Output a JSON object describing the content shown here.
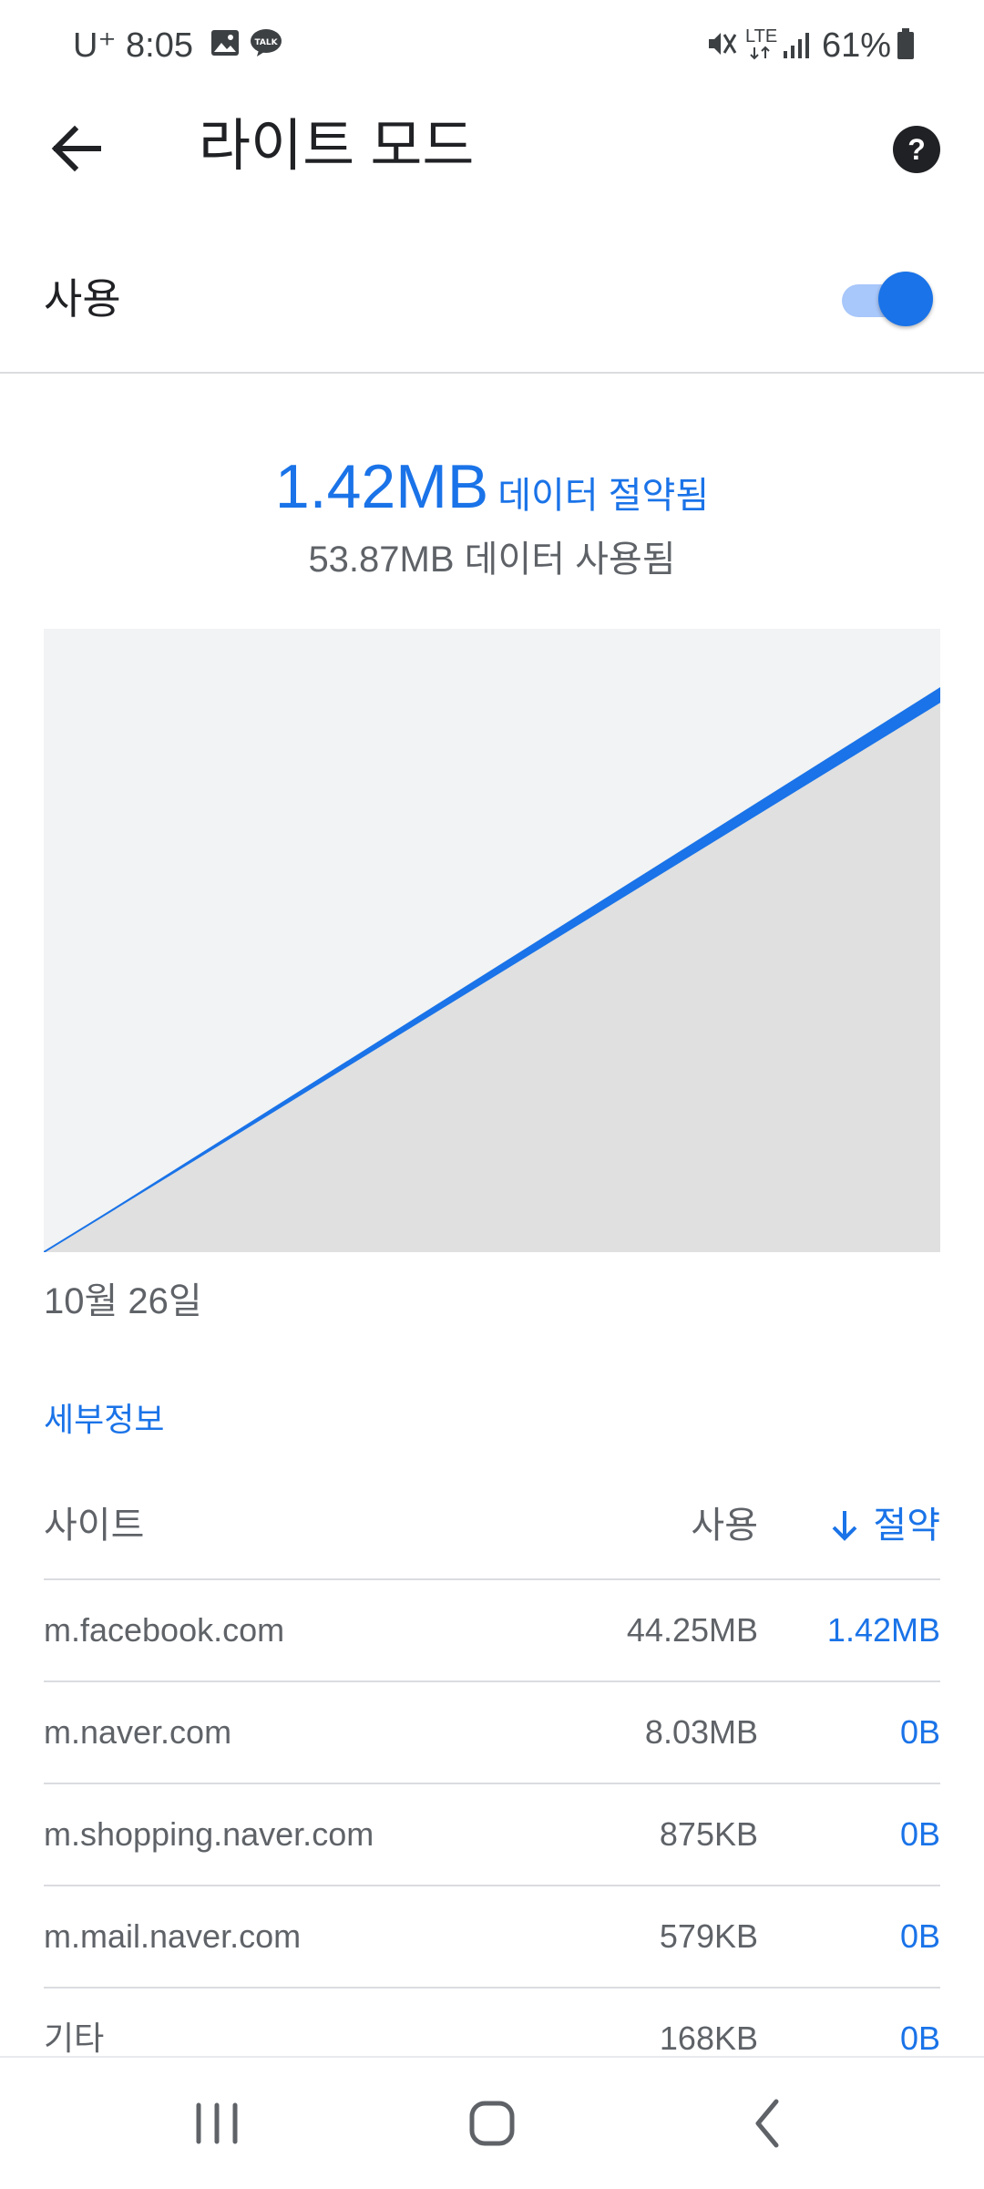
{
  "status_bar": {
    "carrier": "U⁺",
    "time": "8:05",
    "network": "LTE",
    "battery": "61%"
  },
  "toolbar": {
    "title": "라이트 모드"
  },
  "enable": {
    "label": "사용",
    "on": true
  },
  "summary": {
    "saved_amount": "1.42MB",
    "saved_label": "데이터 절약됨",
    "used_text": "53.87MB 데이터 사용됨"
  },
  "chart_data": {
    "type": "area",
    "x": [
      "10월 26일",
      ""
    ],
    "series": [
      {
        "values": [
          0,
          53.87
        ]
      },
      {
        "values": [
          0,
          55.29
        ]
      }
    ],
    "xlabel_start": "10월 26일"
  },
  "details": {
    "link_label": "세부정보",
    "headers": {
      "site": "사이트",
      "used": "사용",
      "saved": "절약"
    },
    "rows": [
      {
        "site": "m.facebook.com",
        "used": "44.25MB",
        "saved": "1.42MB"
      },
      {
        "site": "m.naver.com",
        "used": "8.03MB",
        "saved": "0B"
      },
      {
        "site": "m.shopping.naver.com",
        "used": "875KB",
        "saved": "0B"
      },
      {
        "site": "m.mail.naver.com",
        "used": "579KB",
        "saved": "0B"
      },
      {
        "site": "기타",
        "used": "168KB",
        "saved": "0B"
      }
    ]
  },
  "colors": {
    "accent": "#1a73e8",
    "chart_bg": "#f1f3f4",
    "chart_fill": "#e0e0e0"
  }
}
